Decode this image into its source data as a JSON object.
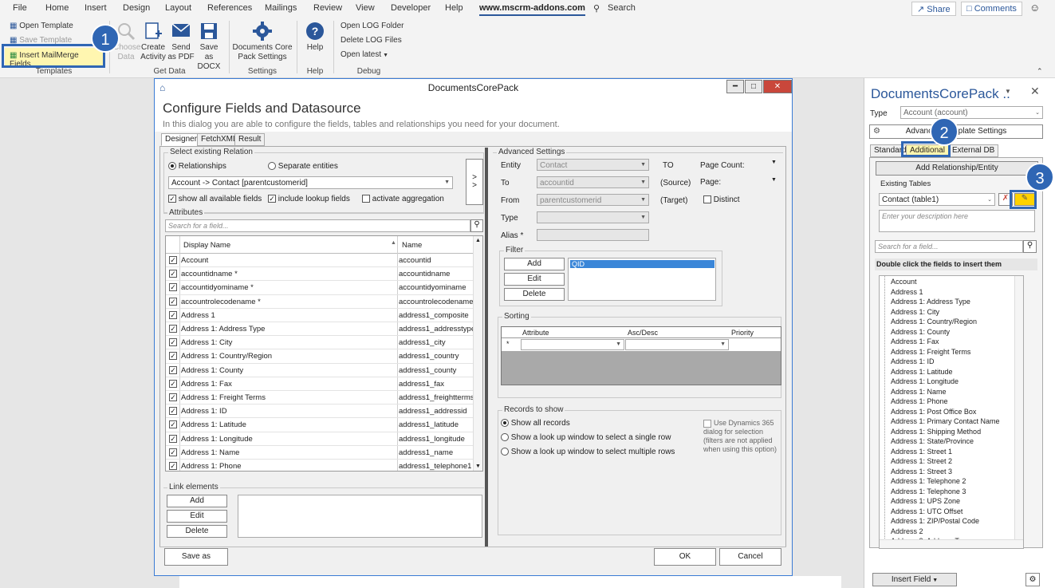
{
  "menu": [
    "File",
    "Home",
    "Insert",
    "Design",
    "Layout",
    "References",
    "Mailings",
    "Review",
    "View",
    "Developer",
    "Help",
    "www.mscrm-addons.com",
    "Search"
  ],
  "menu_right": {
    "share": "Share",
    "comments": "Comments"
  },
  "ribbon": {
    "open_template": "Open Template",
    "save_template": "Save Template",
    "insert_mailmerge": "Insert MailMerge Fields",
    "templates_label": "Templates",
    "choose_data": "Choose Data",
    "create_activity": "Create Activity",
    "send_pdf": "Send as PDF",
    "save_docx": "Save as DOCX",
    "get_data_label": "Get Data",
    "dcp_settings": "Documents Core Pack Settings",
    "settings_label": "Settings",
    "help": "Help",
    "help_label": "Help",
    "open_log": "Open LOG Folder",
    "delete_log": "Delete LOG Files",
    "open_latest": "Open latest",
    "debug_label": "Debug"
  },
  "badges": [
    "1",
    "2",
    "3"
  ],
  "dialog": {
    "title": "DocumentsCorePack",
    "heading": "Configure Fields and Datasource",
    "subtitle": "In this dialog you are able to configure the fields, tables and relationships you need for your document.",
    "tabs": [
      "Designer",
      "FetchXML",
      "Result"
    ],
    "select_relation": "Select existing Relation",
    "relationships": "Relationships",
    "separate_entities": "Separate entities",
    "relation_value": "Account -> Contact   [parentcustomerid]",
    "show_all_fields": "show all available fields",
    "include_lookup": "include lookup fields",
    "activate_aggregation": "activate aggregation",
    "attributes": "Attributes",
    "search_placeholder": "Search for a field...",
    "col_display": "Display Name",
    "col_name": "Name",
    "rows": [
      {
        "display": "Account",
        "name": "accountid"
      },
      {
        "display": "accountidname *",
        "name": "accountidname"
      },
      {
        "display": "accountidyominame *",
        "name": "accountidyominame"
      },
      {
        "display": "accountrolecodename *",
        "name": "accountrolecodename"
      },
      {
        "display": "Address 1",
        "name": "address1_composite"
      },
      {
        "display": "Address 1: Address Type",
        "name": "address1_addresstypec"
      },
      {
        "display": "Address 1: City",
        "name": "address1_city"
      },
      {
        "display": "Address 1: Country/Region",
        "name": "address1_country"
      },
      {
        "display": "Address 1: County",
        "name": "address1_county"
      },
      {
        "display": "Address 1: Fax",
        "name": "address1_fax"
      },
      {
        "display": "Address 1: Freight Terms",
        "name": "address1_freighttermsc"
      },
      {
        "display": "Address 1: ID",
        "name": "address1_addressid"
      },
      {
        "display": "Address 1: Latitude",
        "name": "address1_latitude"
      },
      {
        "display": "Address 1: Longitude",
        "name": "address1_longitude"
      },
      {
        "display": "Address 1: Name",
        "name": "address1_name"
      },
      {
        "display": "Address 1: Phone",
        "name": "address1_telephone1"
      }
    ],
    "link_elements": "Link elements",
    "add": "Add",
    "edit": "Edit",
    "delete": "Delete",
    "save_as": "Save as",
    "ok": "OK",
    "cancel": "Cancel",
    "advanced": {
      "legend": "Advanced Settings",
      "entity_label": "Entity",
      "entity_value": "Contact",
      "to_label": "To",
      "to_value": "accountid",
      "from_label": "From",
      "from_value": "parentcustomerid",
      "type_label": "Type",
      "alias_label": "Alias *",
      "to_caps": "TO",
      "source": "(Source)",
      "target": "(Target)",
      "page_count": "Page Count:",
      "page": "Page:",
      "distinct": "Distinct",
      "filter": "Filter",
      "filter_item": "QID",
      "sorting": "Sorting",
      "sort_attr": "Attribute",
      "sort_dir": "Asc/Desc",
      "sort_priority": "Priority",
      "sort_star": "*",
      "records": "Records to show",
      "show_all": "Show all records",
      "show_single": "Show a look up window to select a single row",
      "show_multi": "Show a look up window to select multiple rows",
      "use_dynamics": "Use Dynamics 365 dialog for selection (filters are not applied when using this option)"
    }
  },
  "pane": {
    "title": "DocumentsCorePack ..",
    "type_label": "Type",
    "type_value": "Account (account)",
    "advanced_btn": "Advanced Template Settings",
    "tabs": [
      "Standard",
      "Additional",
      "External DB"
    ],
    "add_rel": "Add Relationship/Entity",
    "existing_tables": "Existing Tables",
    "table_value": "Contact  (table1)",
    "desc_placeholder": "Enter your description here",
    "search_placeholder": "Search for a field...",
    "hint": "Double click the fields to insert them",
    "fields": [
      "Account",
      "Address 1",
      "Address 1: Address Type",
      "Address 1: City",
      "Address 1: Country/Region",
      "Address 1: County",
      "Address 1: Fax",
      "Address 1: Freight Terms",
      "Address 1: ID",
      "Address 1: Latitude",
      "Address 1: Longitude",
      "Address 1: Name",
      "Address 1: Phone",
      "Address 1: Post Office Box",
      "Address 1: Primary Contact Name",
      "Address 1: Shipping Method",
      "Address 1: State/Province",
      "Address 1: Street 1",
      "Address 1: Street 2",
      "Address 1: Street 3",
      "Address 1: Telephone 2",
      "Address 1: Telephone 3",
      "Address 1: UPS Zone",
      "Address 1: UTC Offset",
      "Address 1: ZIP/Postal Code",
      "Address 2",
      "Address 2: Address Type",
      "Address 2: City"
    ],
    "insert_field": "Insert Field"
  }
}
